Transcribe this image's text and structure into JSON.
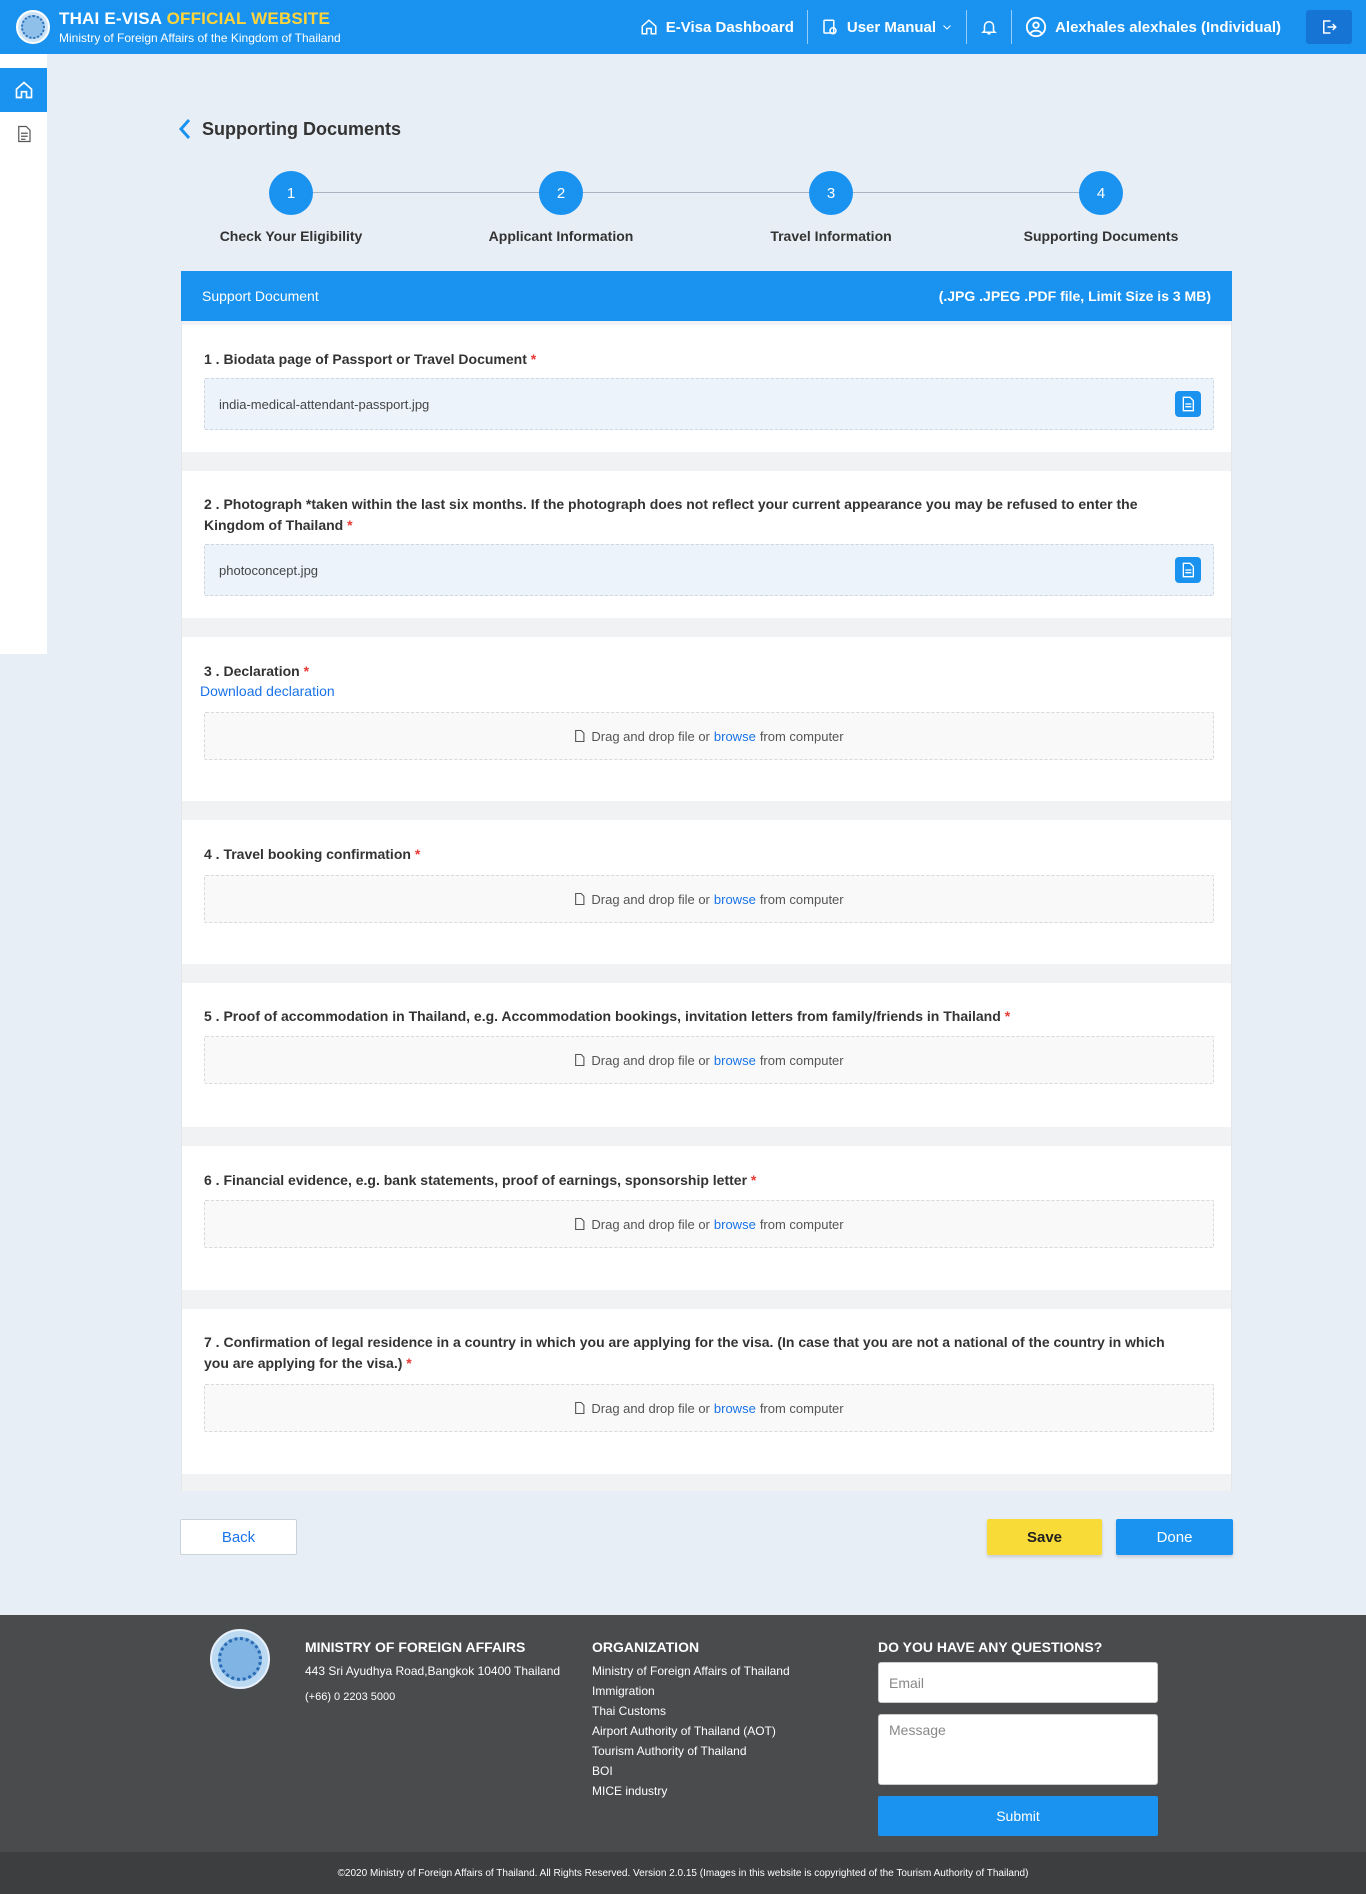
{
  "header": {
    "brand_title_part1": "THAI E-VISA",
    "brand_title_part2": "OFFICIAL WEBSITE",
    "brand_subtitle": "Ministry of Foreign Affairs of the Kingdom of Thailand",
    "nav_dashboard": "E-Visa Dashboard",
    "nav_manual": "User Manual",
    "user_name": "Alexhales alexhales (Individual)"
  },
  "page": {
    "title": "Supporting Documents"
  },
  "stepper": {
    "steps": [
      {
        "number": "1",
        "label": "Check Your Eligibility"
      },
      {
        "number": "2",
        "label": "Applicant Information"
      },
      {
        "number": "3",
        "label": "Travel Information"
      },
      {
        "number": "4",
        "label": "Supporting Documents"
      }
    ]
  },
  "panel": {
    "title": "Support Document",
    "note": "(.JPG .JPEG .PDF file, Limit Size is 3 MB)"
  },
  "documents": [
    {
      "question": "1 . Biodata page of Passport or Travel Document",
      "file": "india-medical-attendant-passport.jpg"
    },
    {
      "question": "2 . Photograph *taken within the last six months. If the photograph does not reflect your current appearance you may be refused to enter the Kingdom of Thailand",
      "file": "photoconcept.jpg"
    },
    {
      "question": "3 . Declaration",
      "link": "Download declaration"
    },
    {
      "question": "4 . Travel booking confirmation"
    },
    {
      "question": "5 . Proof of accommodation in Thailand, e.g. Accommodation bookings, invitation letters from family/friends in Thailand"
    },
    {
      "question": "6 . Financial evidence, e.g. bank statements, proof of earnings, sponsorship letter"
    },
    {
      "question": "7 . Confirmation of legal residence in a country in which you are applying for the visa. (In case that you are not a national of the country in which you are applying for the visa.)"
    }
  ],
  "dropzone": {
    "prefix": "Drag and drop file or",
    "browse": "browse",
    "suffix": "from computer"
  },
  "required_mark": "*",
  "buttons": {
    "back": "Back",
    "save": "Save",
    "done": "Done"
  },
  "footer": {
    "ministry_title": "MINISTRY OF FOREIGN AFFAIRS",
    "address": "443 Sri Ayudhya Road,Bangkok 10400 Thailand",
    "phone": "(+66) 0 2203 5000",
    "org_title": "ORGANIZATION",
    "orgs": [
      "Ministry of Foreign Affairs of Thailand",
      "Immigration",
      "Thai Customs",
      "Airport Authority of Thailand (AOT)",
      "Tourism Authority of Thailand",
      "BOI",
      "MICE industry"
    ],
    "questions_title": "DO YOU HAVE ANY QUESTIONS?",
    "email_placeholder": "Email",
    "message_placeholder": "Message",
    "submit": "Submit",
    "copyright": "©2020 Ministry of Foreign Affairs of Thailand. All Rights Reserved. Version 2.0.15 (Images in this website is copyrighted of the Tourism Authority of Thailand)"
  },
  "colors": {
    "primary": "#1a93f0",
    "accent_yellow": "#ffd43a",
    "save_yellow": "#f9db37",
    "required_red": "#e53935",
    "footer_bg": "#4a4b4d"
  }
}
